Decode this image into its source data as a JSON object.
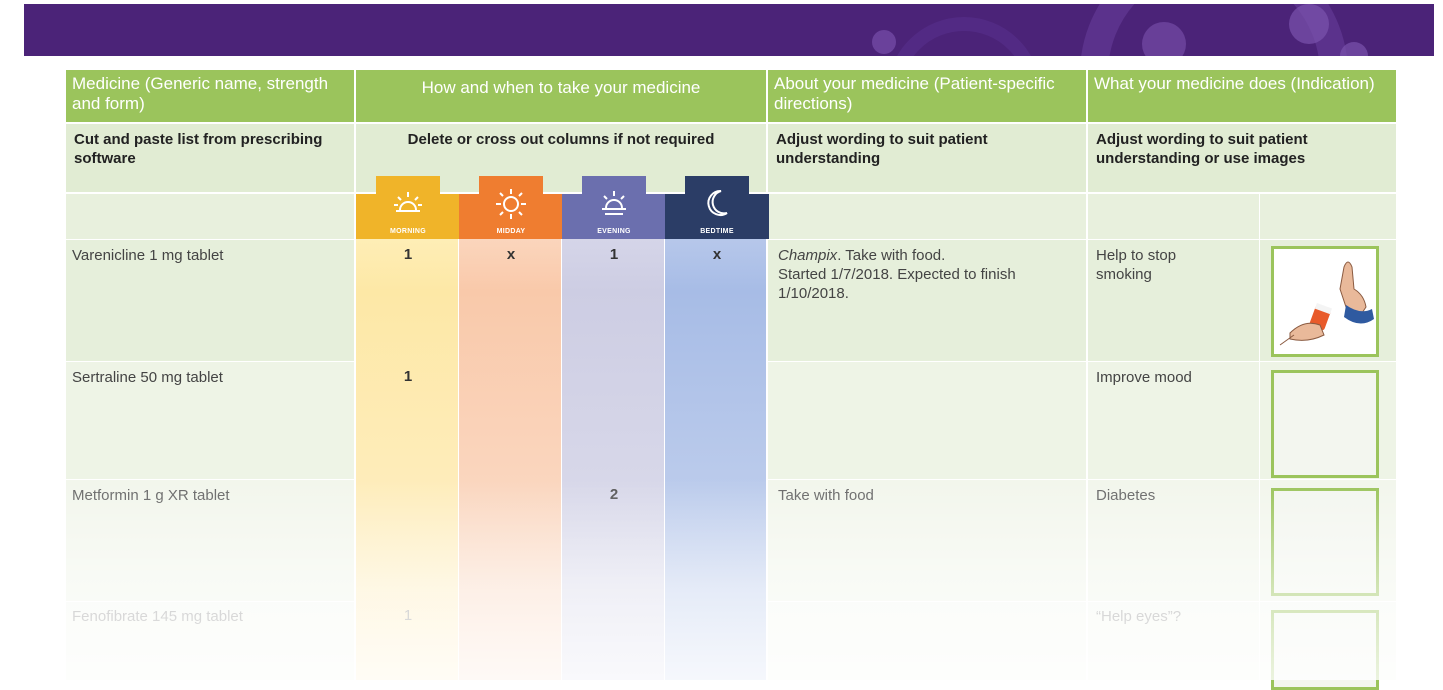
{
  "colors": {
    "banner": "#4b2378",
    "header_green": "#9bc45c",
    "morning": "#f0b429",
    "midday": "#ef7d30",
    "evening": "#6b6fae",
    "bedtime": "#2b3d66"
  },
  "header": {
    "col1": "Medicine (Generic name, strength and form)",
    "col2": "How and when to take your medicine",
    "col3": "About your medicine (Patient-specific directions)",
    "col4": "What your medicine does (Indication)"
  },
  "subheader": {
    "col1": "Cut and paste list from prescribing software",
    "col2": "Delete or cross out columns if not required",
    "col3": "Adjust wording to suit patient understanding",
    "col4": "Adjust wording to suit patient understanding or use images"
  },
  "times": [
    {
      "label": "MORNING",
      "icon": "sunrise-icon"
    },
    {
      "label": "MIDDAY",
      "icon": "sun-icon"
    },
    {
      "label": "EVENING",
      "icon": "sunset-icon"
    },
    {
      "label": "BEDTIME",
      "icon": "moon-icon"
    }
  ],
  "rows": [
    {
      "medicine": "Varenicline 1 mg tablet",
      "morning": "1",
      "midday": "x",
      "evening": "1",
      "bedtime": "x",
      "directions_brand": "Champix",
      "directions_line1": ". Take with food.",
      "directions_line2": "Started 1/7/2018. Expected to finish",
      "directions_line3": "1/10/2018.",
      "indication_line1": "Help to stop",
      "indication_line2": "smoking",
      "image": "stop-smoking-illustration"
    },
    {
      "medicine": "Sertraline 50 mg tablet",
      "morning": "1",
      "midday": "",
      "evening": "",
      "bedtime": "",
      "indication_line1": "Improve mood"
    },
    {
      "medicine": "Metformin 1 g XR tablet",
      "morning": "",
      "midday": "",
      "evening": "2",
      "bedtime": "",
      "directions_line1": "Take with food",
      "indication_line1": "Diabetes"
    },
    {
      "medicine": "Fenofibrate 145 mg tablet",
      "morning": "1",
      "midday": "",
      "evening": "",
      "bedtime": "",
      "indication_line1": "“Help eyes”?"
    }
  ]
}
